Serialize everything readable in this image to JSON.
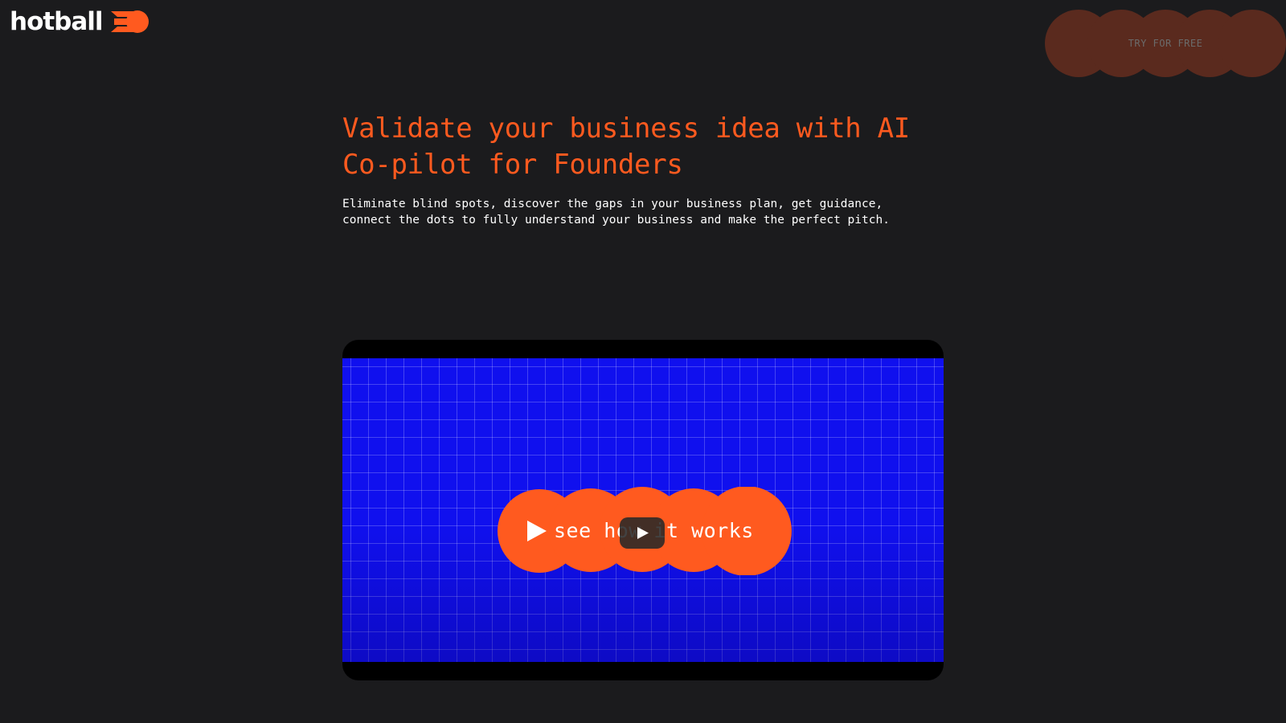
{
  "brand": {
    "name": "hotball",
    "logo_icon": "flame-ball-logo-icon",
    "accent_color": "#ff5a1f"
  },
  "header": {
    "cta_label": "TRY FOR FREE",
    "cta_color": "#5a2a1e"
  },
  "hero": {
    "title": "Validate your business idea with AI Co-pilot for Founders",
    "subtitle": "Eliminate blind spots, discover the gaps in your business plan, get guidance, connect the dots to fully understand your business and make the perfect pitch."
  },
  "video": {
    "background_color": "#1010ee",
    "overlay_button_label": "see how it works",
    "overlay_button_icon": "play-triangle-icon",
    "overlay_button_color": "#ff5a1f",
    "player_play_icon": "play-icon"
  }
}
